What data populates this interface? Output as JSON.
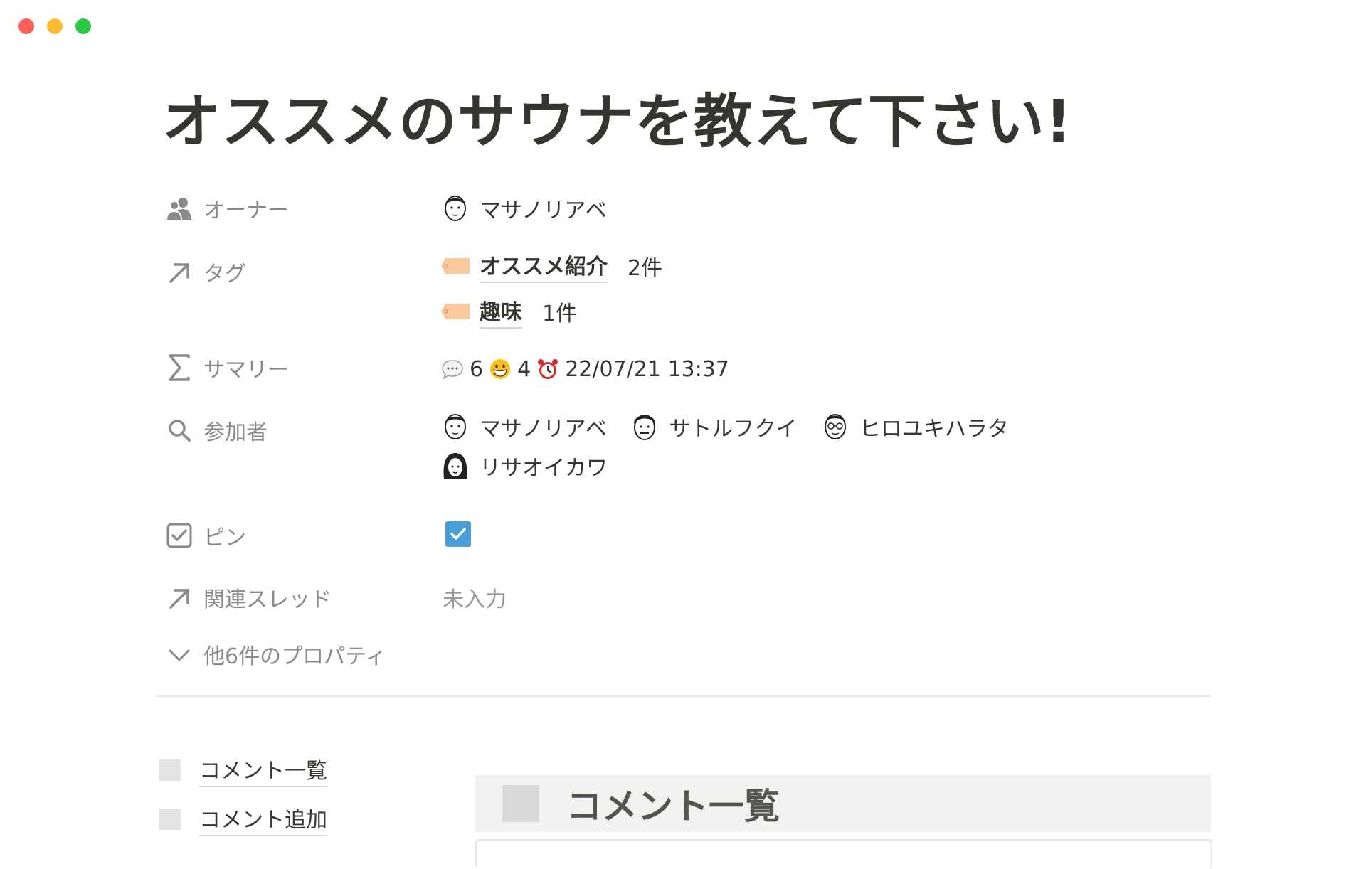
{
  "title": "オススメのサウナを教えて下さい!",
  "properties": {
    "owner": {
      "label": "オーナー",
      "person": "マサノリアベ"
    },
    "tag": {
      "label": "タグ",
      "items": [
        {
          "name": "オススメ紹介",
          "count": "2件"
        },
        {
          "name": "趣味",
          "count": "1件"
        }
      ]
    },
    "summary": {
      "label": "サマリー",
      "comments": "6",
      "reactions": "4",
      "datetime": "22/07/21 13:37"
    },
    "participants": {
      "label": "参加者",
      "people": [
        "マサノリアベ",
        "サトルフクイ",
        "ヒロユキハラタ",
        "リサオイカワ"
      ]
    },
    "pin": {
      "label": "ピン",
      "checked": true
    },
    "related": {
      "label": "関連スレッド",
      "value": "未入力"
    },
    "more": {
      "label": "他6件のプロパティ"
    }
  },
  "toc": [
    "コメント一覧",
    "コメント追加"
  ],
  "section": {
    "title": "コメント一覧"
  },
  "colors": {
    "text": "#37352f",
    "muted": "#8a8a86",
    "checkbox": "#4a9fd6",
    "tag": "#f8c99a",
    "callout_bg": "#f1f1ef"
  }
}
